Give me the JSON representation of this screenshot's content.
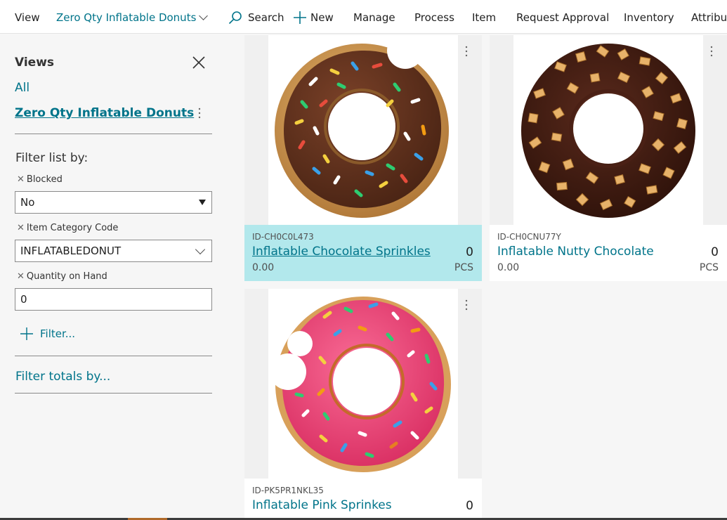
{
  "topbar": {
    "view_label": "View",
    "view_name": "Zero Qty Inflatable Donuts",
    "actions": [
      "Search",
      "New",
      "Manage",
      "Process",
      "Item",
      "Request Approval",
      "Inventory",
      "Attributes"
    ]
  },
  "sidebar": {
    "title": "Views",
    "all_label": "All",
    "current_view": "Zero Qty Inflatable Donuts",
    "filter_heading": "Filter list by:",
    "filters": [
      {
        "label": "Blocked",
        "value": "No"
      },
      {
        "label": "Item Category Code",
        "value": "INFLATABLEDONUT"
      },
      {
        "label": "Quantity on Hand",
        "value": "0"
      }
    ],
    "add_filter_label": "Filter...",
    "totals_label": "Filter totals by..."
  },
  "colors": {
    "accent": "#00748a",
    "selected_tile": "#b2e8ec",
    "chocolate": "#5a2d1a",
    "dark_chocolate": "#3a1a10",
    "pink_icing": "#f2477a",
    "dough": "#d4a35a",
    "nut": "#e7b26a"
  },
  "tiles": [
    {
      "code": "ID-CH0C0L473",
      "name": "Inflatable Chocolate Sprinkles",
      "qty": "0",
      "price": "0.00",
      "uom": "PCS",
      "image": "chocolate-sprinkles-donut",
      "selected": true
    },
    {
      "code": "ID-CH0CNU77Y",
      "name": "Inflatable Nutty Chocolate",
      "qty": "0",
      "price": "0.00",
      "uom": "PCS",
      "image": "nutty-chocolate-donut",
      "selected": false
    },
    {
      "code": "ID-PK5PR1NKL35",
      "name": "Inflatable Pink Sprinkes",
      "qty": "0",
      "price": "",
      "uom": "",
      "image": "pink-sprinkles-donut",
      "selected": false
    }
  ]
}
